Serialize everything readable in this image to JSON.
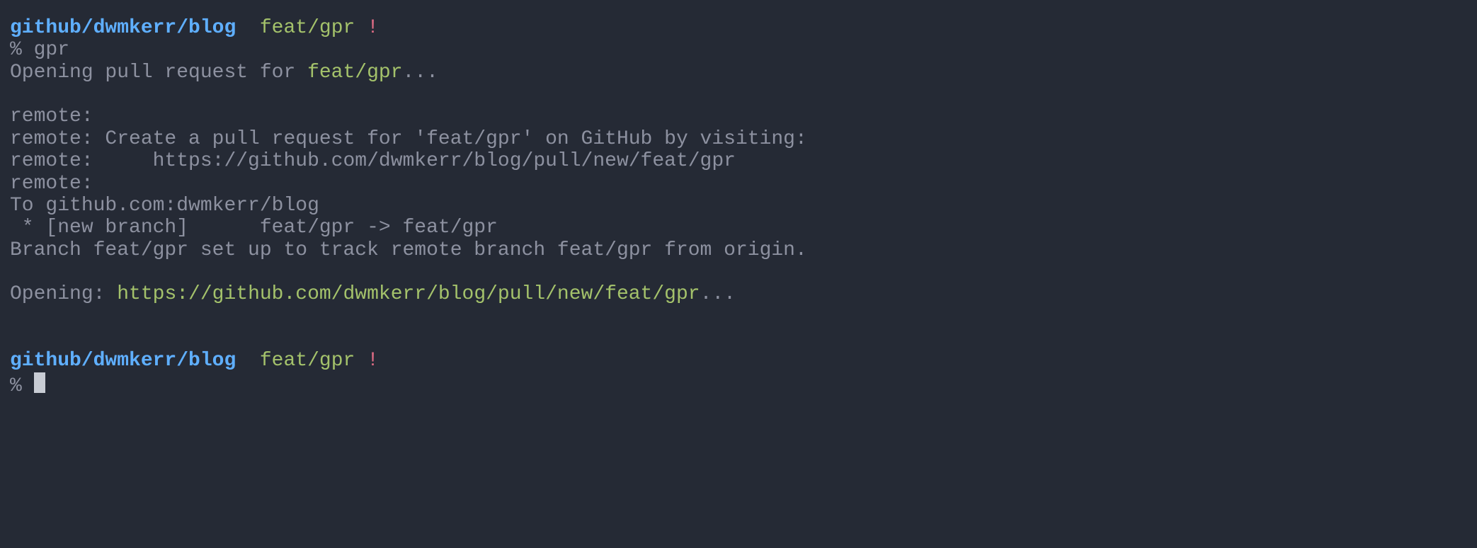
{
  "prompt1": {
    "path": "github/dwmkerr/blog",
    "sepA": "  ",
    "branch": "feat/gpr",
    "sepB": " ",
    "bang": "!",
    "ps": "%",
    "sepCmd": " ",
    "cmd": "gpr"
  },
  "output": {
    "open_prefix": "Opening pull request for ",
    "open_branch": "feat/gpr",
    "open_suffix": "...",
    "blank": "",
    "r1": "remote:",
    "r2": "remote: Create a pull request for 'feat/gpr' on GitHub by visiting:",
    "r3": "remote:     https://github.com/dwmkerr/blog/pull/new/feat/gpr",
    "r4": "remote:",
    "to": "To github.com:dwmkerr/blog",
    "new_branch": " * [new branch]      feat/gpr -> feat/gpr",
    "track": "Branch feat/gpr set up to track remote branch feat/gpr from origin.",
    "opening_prefix": "Opening: ",
    "opening_url": "https://github.com/dwmkerr/blog/pull/new/feat/gpr",
    "opening_suffix": "..."
  },
  "prompt2": {
    "path": "github/dwmkerr/blog",
    "sepA": "  ",
    "branch": "feat/gpr",
    "sepB": " ",
    "bang": "!",
    "ps": "%",
    "sepCmd": " "
  }
}
